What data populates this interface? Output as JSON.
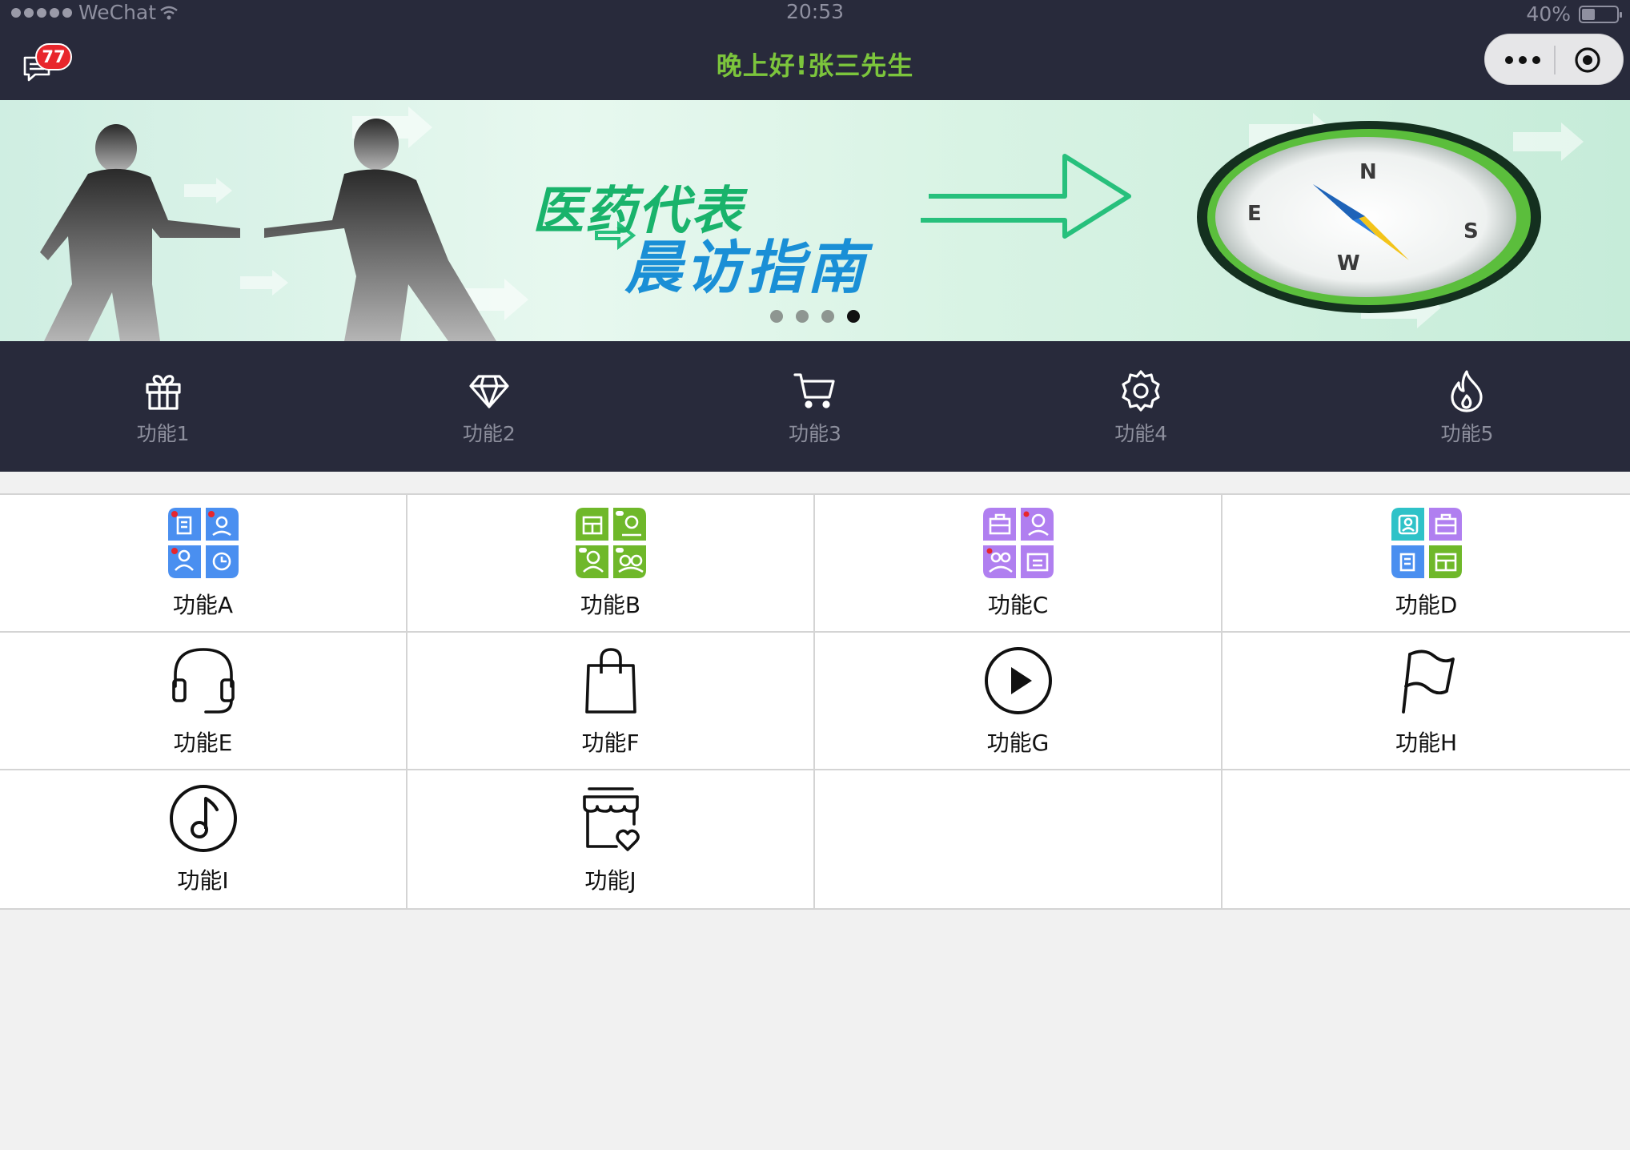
{
  "status": {
    "carrier": "WeChat",
    "time": "20:53",
    "battery": "40%",
    "battery_level": 0.4
  },
  "nav": {
    "title": "晚上好!张三先生",
    "message_badge": "77",
    "title_color": "#7cc53c",
    "bar_color": "#282a3b"
  },
  "banner": {
    "line1": "医药代表",
    "line2": "晨访指南",
    "compass_letters": [
      "N",
      "E",
      "S",
      "W"
    ],
    "page_count": 4,
    "active_page": 4
  },
  "quick_functions": [
    {
      "label": "功能1",
      "icon": "gift-icon"
    },
    {
      "label": "功能2",
      "icon": "diamond-icon"
    },
    {
      "label": "功能3",
      "icon": "cart-icon"
    },
    {
      "label": "功能4",
      "icon": "gear-icon"
    },
    {
      "label": "功能5",
      "icon": "flame-icon"
    }
  ],
  "grid_functions": [
    {
      "label": "功能A",
      "icon": "quad-blue-icon"
    },
    {
      "label": "功能B",
      "icon": "quad-green-icon"
    },
    {
      "label": "功能C",
      "icon": "quad-purple-icon"
    },
    {
      "label": "功能D",
      "icon": "quad-multicolor-icon"
    },
    {
      "label": "功能E",
      "icon": "headset-icon"
    },
    {
      "label": "功能F",
      "icon": "shopping-bag-icon"
    },
    {
      "label": "功能G",
      "icon": "play-circle-icon"
    },
    {
      "label": "功能H",
      "icon": "flag-icon"
    },
    {
      "label": "功能I",
      "icon": "music-note-icon"
    },
    {
      "label": "功能J",
      "icon": "store-heart-icon"
    }
  ]
}
